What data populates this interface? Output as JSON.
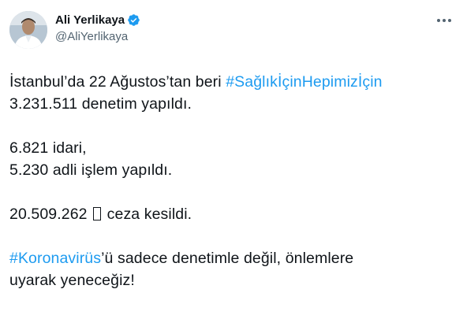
{
  "author": {
    "name": "Ali Yerlikaya",
    "handle": "@AliYerlikaya"
  },
  "icons": {
    "verified": "verified-badge-icon",
    "more": "more-horizontal-icon"
  },
  "colors": {
    "link": "#1d9bf0",
    "verified": "#1d9bf0",
    "text": "#0f1419",
    "secondary": "#536471"
  },
  "tweet": {
    "p1_line1_text": "İstanbul’da 22 Ağustos’tan beri ",
    "p1_line1_hashtag": "#SağlıkİçinHepimizİçin",
    "p1_line2": "3.231.511 denetim yapıldı.",
    "p2_line1": "6.821 idari,",
    "p2_line2": "5.230 adli işlem yapıldı.",
    "p3_line1_amount": "20.509.262",
    "p3_line1_rest": " ceza kesildi.",
    "p4_line1_hashtag": "#Koronavirüs",
    "p4_line1_text": "’ü sadece denetimle değil, önlemlere",
    "p4_line2": "uyarak yeneceğiz!"
  }
}
